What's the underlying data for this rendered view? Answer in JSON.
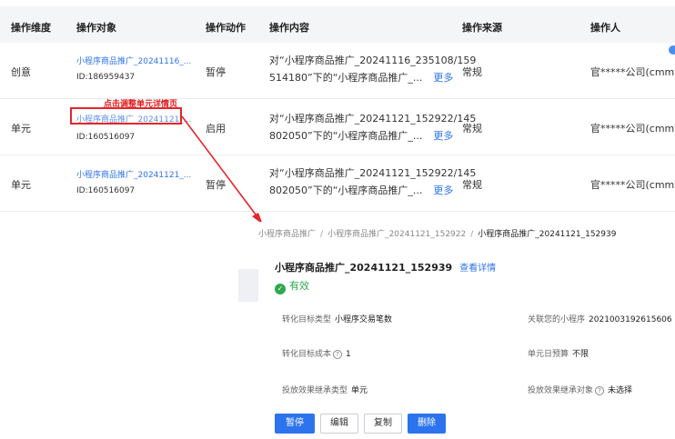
{
  "table": {
    "headers": [
      "操作维度",
      "操作对象",
      "操作动作",
      "操作内容",
      "操作来源",
      "操作人"
    ],
    "rows": [
      {
        "dimension": "创意",
        "object_name": "小程序商品推广_20241116_...",
        "object_id": "ID:186959437",
        "action": "暂停",
        "content_line1": "对“小程序商品推广_20241116_235108/159",
        "content_line2": "514180”下的“小程序商品推广_...",
        "more": "更多",
        "source": "常规",
        "operator": "官*****公司(cmmvh"
      },
      {
        "dimension": "单元",
        "object_name": "小程序商品推广_20241121_...",
        "object_id": "ID:160516097",
        "action": "启用",
        "content_line1": "对“小程序商品推广_20241121_152922/145",
        "content_line2": "802050”下的“小程序商品推广_...",
        "more": "更多",
        "source": "常规",
        "operator": "官*****公司(cmmvh"
      },
      {
        "dimension": "单元",
        "object_name": "小程序商品推广_20241121_...",
        "object_id": "ID:160516097",
        "action": "暂停",
        "content_line1": "对“小程序商品推广_20241121_152922/145",
        "content_line2": "802050”下的“小程序商品推广_...",
        "more": "更多",
        "source": "常规",
        "operator": "官*****公司(cmmvh"
      }
    ]
  },
  "annotation": {
    "text": "点击调整单元详情页",
    "color": "#e8242a"
  },
  "detail": {
    "breadcrumb": [
      "小程序商品推广",
      "小程序商品推广_20241121_152922",
      "小程序商品推广_20241121_152939"
    ],
    "breadcrumb_sep": "/",
    "title": "小程序商品推广_20241121_152939",
    "title_link": "查看详情",
    "status": "有效",
    "fields": {
      "conv_type_label": "转化目标类型",
      "conv_type_value": "小程序交易笔数",
      "mini_program_label": "关联您的小程序",
      "mini_program_value": "2021003192615606",
      "conv_cost_label": "转化目标成本",
      "conv_cost_value": "1",
      "daily_budget_label": "单元日预算",
      "daily_budget_value": "不限",
      "inherit_type_label": "投放效果继承类型",
      "inherit_type_value": "单元",
      "inherit_target_label": "投放效果继承对象",
      "inherit_target_value": "未选择"
    },
    "buttons": {
      "pause": "暂停",
      "edit": "编辑",
      "copy": "复制",
      "delete": "删除"
    }
  },
  "colors": {
    "link": "#2d73ee",
    "success": "#2fa84f",
    "header_bg": "#f4f5f7"
  }
}
